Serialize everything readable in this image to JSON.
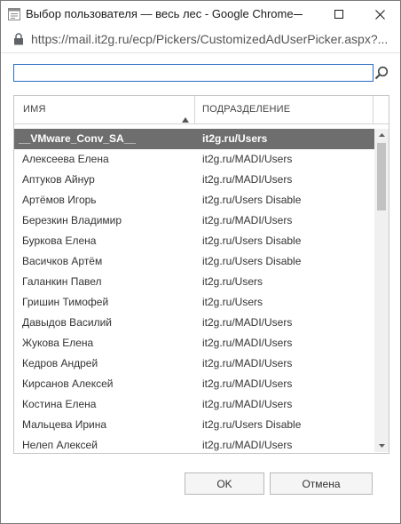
{
  "window": {
    "title": "Выбор пользователя — весь лес - Google Chrome"
  },
  "address": {
    "url_scheme": "https://",
    "url_host": "mail.it2g.ru",
    "url_path": "/ecp/Pickers/CustomizedAdUserPicker.aspx?..."
  },
  "search": {
    "value": "",
    "placeholder": ""
  },
  "grid": {
    "columns": [
      "ИМЯ",
      "ПОДРАЗДЕЛЕНИЕ"
    ],
    "sort": "ascending",
    "selected_index": 0,
    "rows": [
      {
        "name": "__VMware_Conv_SA__",
        "dept": "it2g.ru/Users"
      },
      {
        "name": "Алексеева Елена",
        "dept": "it2g.ru/MADI/Users"
      },
      {
        "name": "Аптуков Айнур",
        "dept": "it2g.ru/MADI/Users"
      },
      {
        "name": "Артёмов Игорь",
        "dept": "it2g.ru/Users Disable"
      },
      {
        "name": "Березкин Владимир",
        "dept": "it2g.ru/MADI/Users"
      },
      {
        "name": "Буркова Елена",
        "dept": "it2g.ru/Users Disable"
      },
      {
        "name": "Васичков Артём",
        "dept": "it2g.ru/Users Disable"
      },
      {
        "name": "Галанкин Павел",
        "dept": "it2g.ru/Users"
      },
      {
        "name": "Гришин Тимофей",
        "dept": "it2g.ru/Users"
      },
      {
        "name": "Давыдов Василий",
        "dept": "it2g.ru/MADI/Users"
      },
      {
        "name": "Жукова Елена",
        "dept": "it2g.ru/MADI/Users"
      },
      {
        "name": "Кедров Андрей",
        "dept": "it2g.ru/MADI/Users"
      },
      {
        "name": "Кирсанов Алексей",
        "dept": "it2g.ru/MADI/Users"
      },
      {
        "name": "Костина Елена",
        "dept": "it2g.ru/MADI/Users"
      },
      {
        "name": "Мальцева Ирина",
        "dept": "it2g.ru/Users Disable"
      },
      {
        "name": "Нелеп Алексей",
        "dept": "it2g.ru/MADI/Users"
      }
    ]
  },
  "buttons": {
    "ok": "OK",
    "cancel": "Отмена"
  },
  "icons": {
    "app": "chrome-page-icon",
    "lock": "lock-icon",
    "search": "search-icon",
    "sort": "sort-ascending-icon"
  },
  "colors": {
    "selected_row": "#6e6e6e",
    "input_border": "#2b6cc4"
  }
}
